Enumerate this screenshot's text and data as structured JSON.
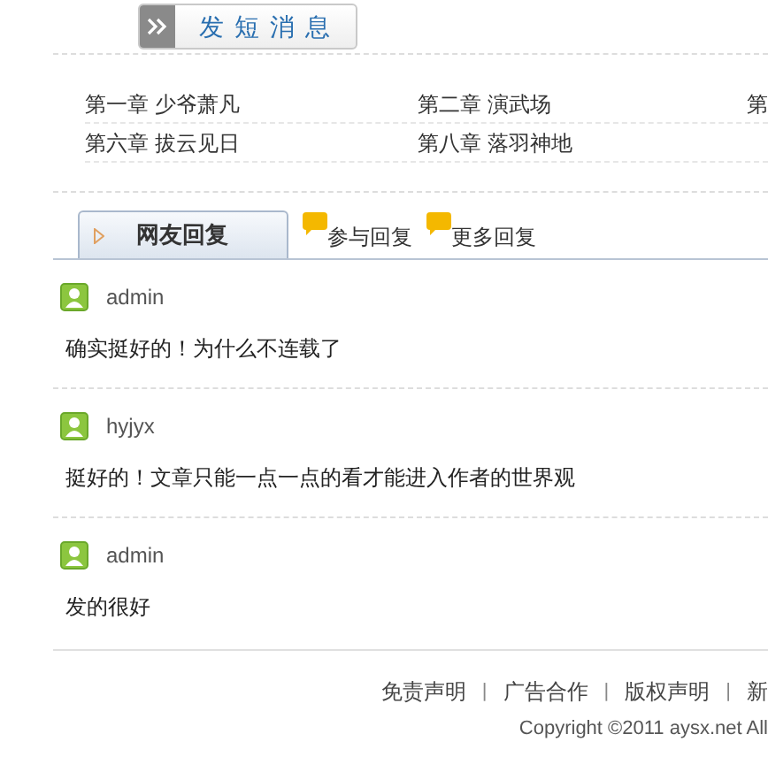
{
  "message_button": {
    "label": "发 短 消 息"
  },
  "chapter_rows": [
    [
      "第一章 少爷萧凡",
      "第二章 演武场",
      "第"
    ],
    [
      "第六章 拔云见日",
      "第八章 落羽神地"
    ]
  ],
  "tabs": [
    {
      "label": "网友回复",
      "selected": true
    },
    {
      "label": "参与回复",
      "selected": false
    },
    {
      "label": "更多回复",
      "selected": false
    }
  ],
  "comments": [
    {
      "user": "admin",
      "text": "确实挺好的！为什么不连载了"
    },
    {
      "user": "hyjyx",
      "text": "挺好的！文章只能一点一点的看才能进入作者的世界观"
    },
    {
      "user": "admin",
      "text": "发的很好"
    }
  ],
  "footer": {
    "items": [
      {
        "kind": "link",
        "text": "免责声明"
      },
      {
        "kind": "separator",
        "text": "|"
      },
      {
        "kind": "link",
        "text": "广告合作"
      },
      {
        "kind": "separator",
        "text": "|"
      },
      {
        "kind": "link",
        "text": "版权声明"
      },
      {
        "kind": "separator",
        "text": "|"
      },
      {
        "kind": "link",
        "text": "新"
      }
    ],
    "copyright": "Copyright ©2011 aysx.net All"
  }
}
